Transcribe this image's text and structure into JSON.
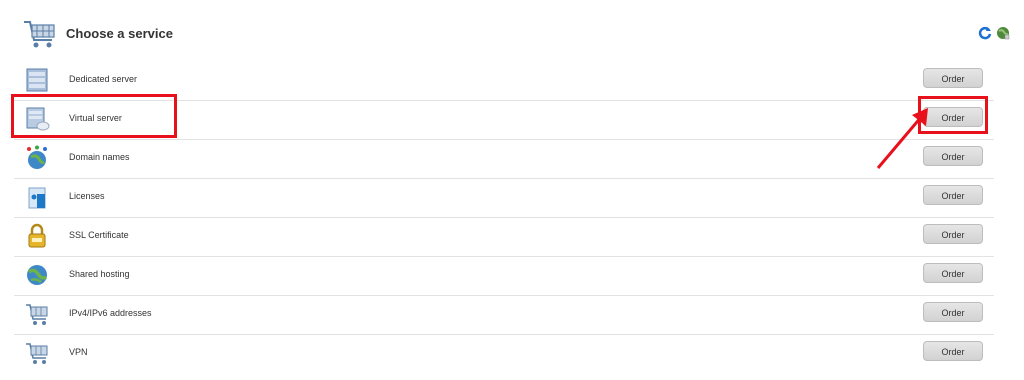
{
  "header": {
    "title": "Choose a service",
    "refresh_icon": "refresh-icon",
    "globe_icon": "globe-icon"
  },
  "services": [
    {
      "name": "Dedicated server",
      "icon": "dedicated-server-icon",
      "button": "Order"
    },
    {
      "name": "Virtual server",
      "icon": "virtual-server-icon",
      "button": "Order"
    },
    {
      "name": "Domain names",
      "icon": "domain-globe-icon",
      "button": "Order"
    },
    {
      "name": "Licenses",
      "icon": "licenses-icon",
      "button": "Order"
    },
    {
      "name": "SSL Certificate",
      "icon": "ssl-lock-icon",
      "button": "Order"
    },
    {
      "name": "Shared hosting",
      "icon": "shared-hosting-globe-icon",
      "button": "Order"
    },
    {
      "name": "IPv4/IPv6 addresses",
      "icon": "cart-icon",
      "button": "Order"
    },
    {
      "name": "VPN",
      "icon": "cart-icon",
      "button": "Order"
    }
  ],
  "highlight_color": "#e8101a"
}
